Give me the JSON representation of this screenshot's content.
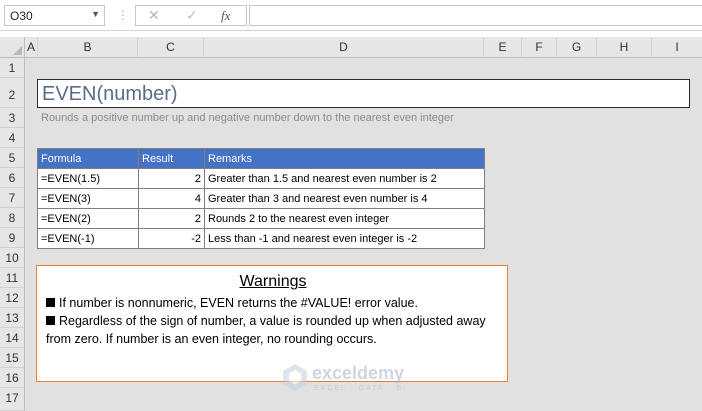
{
  "formula_bar": {
    "name_box": "O30",
    "formula": "",
    "cancel_glyph": "✕",
    "enter_glyph": "✓",
    "fx_label": "fx"
  },
  "columns": [
    "A",
    "B",
    "C",
    "D",
    "E",
    "F",
    "G",
    "H",
    "I"
  ],
  "rows": [
    "1",
    "2",
    "3",
    "4",
    "5",
    "6",
    "7",
    "8",
    "9",
    "10",
    "11",
    "12",
    "13",
    "14",
    "15",
    "16",
    "17"
  ],
  "sheet": {
    "title": "EVEN(number)",
    "description": "Rounds a positive number up and negative number down to the nearest even integer",
    "table": {
      "headers": [
        "Formula",
        "Result",
        "Remarks"
      ],
      "rows": [
        [
          "=EVEN(1.5)",
          "2",
          "Greater than 1.5 and nearest even number  is 2"
        ],
        [
          "=EVEN(3)",
          "4",
          "Greater than 3 and nearest even number is 4"
        ],
        [
          "=EVEN(2)",
          "2",
          "Rounds 2 to the nearest even integer"
        ],
        [
          "=EVEN(-1)",
          "-2",
          "Less than -1 and nearest even integer is -2"
        ]
      ]
    },
    "warnings": {
      "title": "Warnings",
      "items": [
        "If number is nonnumeric, EVEN returns the #VALUE! error value.",
        "Regardless of the sign of number, a value is rounded up when adjusted away from zero. If number is an even integer, no rounding occurs."
      ]
    }
  },
  "watermark": {
    "name": "exceldemy",
    "tagline": "EXCEL · DATA · BI"
  },
  "colors": {
    "header_fill": "#4472c4",
    "warning_border": "#ed7d31",
    "title_text": "#5b6d86"
  }
}
